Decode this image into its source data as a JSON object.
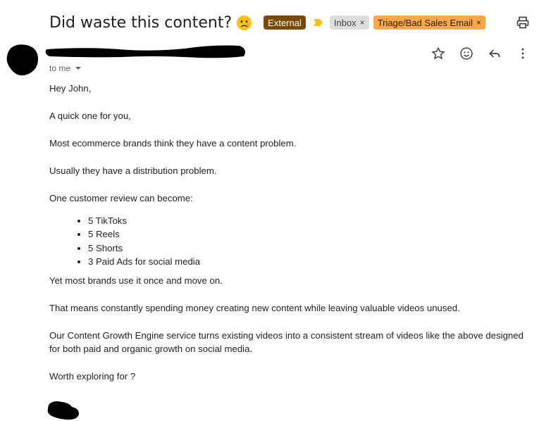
{
  "email": {
    "subject": "Did waste this content?",
    "labels": {
      "external": "External",
      "inbox": "Inbox",
      "triage": "Triage/Bad Sales Email",
      "remove_symbol": "×"
    },
    "recipient_line": "to me",
    "body": {
      "greeting": "Hey John,",
      "p1": "A quick one for you,",
      "p2": "Most ecommerce brands think they have a content problem.",
      "p3": "Usually they have a distribution problem.",
      "p4": "One customer review can become:",
      "bullets": [
        "5 TikToks",
        "5 Reels",
        "5 Shorts",
        "3 Paid Ads for social media"
      ],
      "p5": "Yet most brands use it once and move on.",
      "p6": "That means constantly spending money creating new content while leaving valuable videos unused.",
      "p7": "Our Content Growth Engine service turns existing videos into a consistent stream of videos like the above designed for both paid and organic growth on social media.",
      "p8": "Worth exploring for ?"
    }
  },
  "icons": {
    "subject_emoji": "crying-face-emoji",
    "print": "print-icon",
    "star": "star-icon",
    "emoji_reaction": "emoji-icon",
    "reply": "reply-icon",
    "more": "more-vert-icon",
    "importance": "importance-marker-icon"
  },
  "colors": {
    "external_badge": "#7b4a00",
    "inbox_badge": "#dddddd",
    "triage_badge": "#f9a94b",
    "importance_marker": "#f4c20d",
    "redaction": "#000000"
  }
}
